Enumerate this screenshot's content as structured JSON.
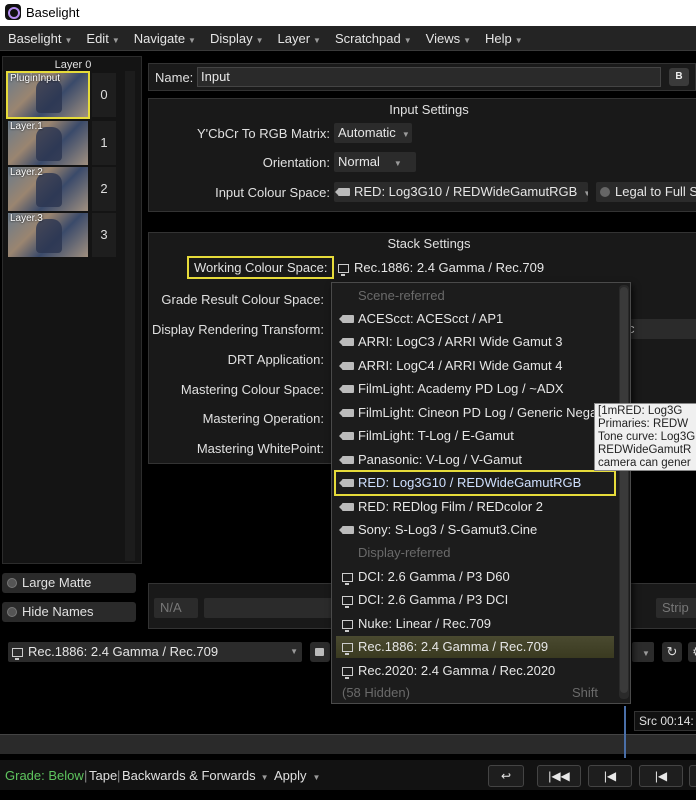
{
  "app": {
    "title": "Baselight"
  },
  "menu": [
    "Baselight",
    "Edit",
    "Navigate",
    "Display",
    "Layer",
    "Scratchpad",
    "Views",
    "Help"
  ],
  "layers": {
    "header": "Layer 0",
    "items": [
      {
        "label": "PluginInput",
        "num": "0"
      },
      {
        "label": "Layer.1",
        "num": "1"
      },
      {
        "label": "Layer.2",
        "num": "2"
      },
      {
        "label": "Layer.3",
        "num": "3"
      }
    ],
    "large_matte": "Large Matte",
    "hide_names": "Hide Names"
  },
  "name": {
    "label": "Name:",
    "value": "Input",
    "button": "B"
  },
  "input_settings": {
    "title": "Input Settings",
    "matrix_label": "Y'CbCr To RGB Matrix:",
    "matrix_value": "Automatic",
    "orientation_label": "Orientation:",
    "orientation_value": "Normal",
    "colour_space_label": "Input Colour Space:",
    "colour_space_value": "RED: Log3G10 / REDWideGamutRGB",
    "legal_button": "Legal to Full S"
  },
  "stack_settings": {
    "title": "Stack Settings",
    "working_label": "Working Colour Space:",
    "working_value": "Rec.1886: 2.4 Gamma / Rec.709",
    "grade_result_label": "Grade Result Colour Space:",
    "drt_label": "Display Rendering Transform:",
    "drt_partial": "c",
    "drt_app_label": "DRT Application:",
    "mastering_cs_label": "Mastering Colour Space:",
    "mastering_op_label": "Mastering Operation:",
    "mastering_wp_label": "Mastering WhitePoint:"
  },
  "popup": {
    "scene_header": "Scene-referred",
    "scene_items": [
      "ACEScct: ACEScct / AP1",
      "ARRI: LogC3 / ARRI Wide Gamut 3",
      "ARRI: LogC4 / ARRI Wide Gamut 4",
      "FilmLight: Academy PD Log / ~ADX",
      "FilmLight: Cineon PD Log / Generic Negative",
      "FilmLight: T-Log / E-Gamut",
      "Panasonic: V-Log / V-Gamut",
      "RED: Log3G10 / REDWideGamutRGB",
      "RED: REDlog Film / REDcolor 2",
      "Sony: S-Log3 / S-Gamut3.Cine"
    ],
    "display_header": "Display-referred",
    "display_items": [
      "DCI: 2.6 Gamma / P3 D60",
      "DCI: 2.6 Gamma / P3 DCI",
      "Nuke: Linear / Rec.709",
      "Rec.1886: 2.4 Gamma / Rec.709",
      "Rec.2020: 2.4 Gamma / Rec.2020"
    ],
    "hidden": "(58 Hidden)",
    "shift": "Shift"
  },
  "tooltip": [
    "[1mRED: Log3G",
    "Primaries: REDW",
    "Tone curve: Log3G",
    "REDWideGamutR",
    "camera can gener"
  ],
  "lower": {
    "na": "N/A",
    "strip": "Strip"
  },
  "bottom": {
    "colour_space": "Rec.1886: 2.4 Gamma / Rec.709",
    "src": "Src 00:14:"
  },
  "status": {
    "grade_label": "Grade:",
    "grade_value": "Below",
    "tape": "Tape",
    "mode": "Backwards & Forwards",
    "apply": "Apply"
  }
}
